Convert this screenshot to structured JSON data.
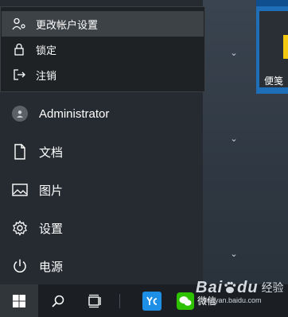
{
  "account_menu": {
    "items": [
      {
        "label": "更改帐户设置",
        "icon": "account-settings-icon"
      },
      {
        "label": "锁定",
        "icon": "lock-icon"
      },
      {
        "label": "注销",
        "icon": "sign-out-icon"
      }
    ]
  },
  "start_menu": {
    "user_name": "Administrator",
    "items": [
      {
        "label": "文档",
        "icon": "document-icon"
      },
      {
        "label": "图片",
        "icon": "pictures-icon"
      },
      {
        "label": "设置",
        "icon": "gear-icon"
      },
      {
        "label": "电源",
        "icon": "power-icon"
      }
    ]
  },
  "tiles": {
    "sticky_notes_label": "便笺"
  },
  "taskbar": {
    "wechat_label": "微信"
  },
  "watermark": {
    "brand": "Bai",
    "brand_tail": "du",
    "suffix": "经验",
    "url": "jingyan.baidu.com"
  },
  "colors": {
    "accent": "#1f6fb8",
    "sticky_yellow": "#f2c811",
    "taskbar_bg": "#1b1f23"
  }
}
